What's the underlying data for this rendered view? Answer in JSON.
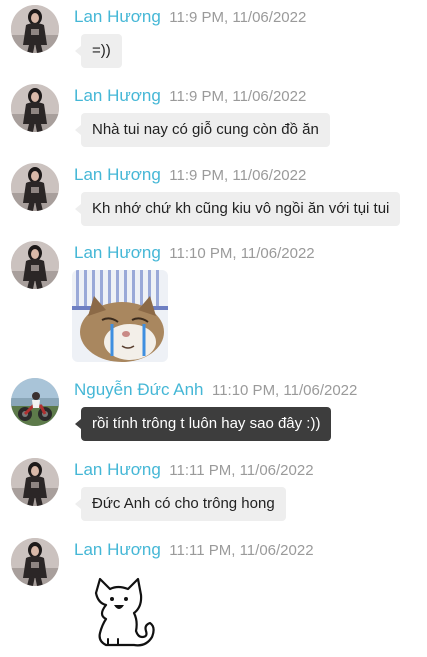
{
  "colors": {
    "name": "#45b7d6",
    "time": "#9a9a9a",
    "bubble": "#eeeeee",
    "bubble_dark": "#3d3d3d"
  },
  "messages": [
    {
      "sender": "Lan Hương",
      "time": "11:9 PM, 11/06/2022",
      "text": "=))"
    },
    {
      "sender": "Lan Hương",
      "time": "11:9 PM, 11/06/2022",
      "text": "Nhà tui nay có giỗ cung còn đồ ăn"
    },
    {
      "sender": "Lan Hương",
      "time": "11:9 PM, 11/06/2022",
      "text": "Kh nhớ chứ kh cũng kiu vô ngồi ăn với tụi tui"
    },
    {
      "sender": "Lan Hương",
      "time": "11:10 PM, 11/06/2022",
      "sticker": "crying-cat-sticker"
    },
    {
      "sender": "Nguyễn Đức Anh",
      "time": "11:10 PM, 11/06/2022",
      "text": "rồi tính trông t luôn hay sao đây :))"
    },
    {
      "sender": "Lan Hương",
      "time": "11:11 PM, 11/06/2022",
      "text": "Đức Anh có cho trông hong"
    },
    {
      "sender": "Lan Hương",
      "time": "11:11 PM, 11/06/2022",
      "sticker": "cartoon-cat-sticker"
    }
  ]
}
